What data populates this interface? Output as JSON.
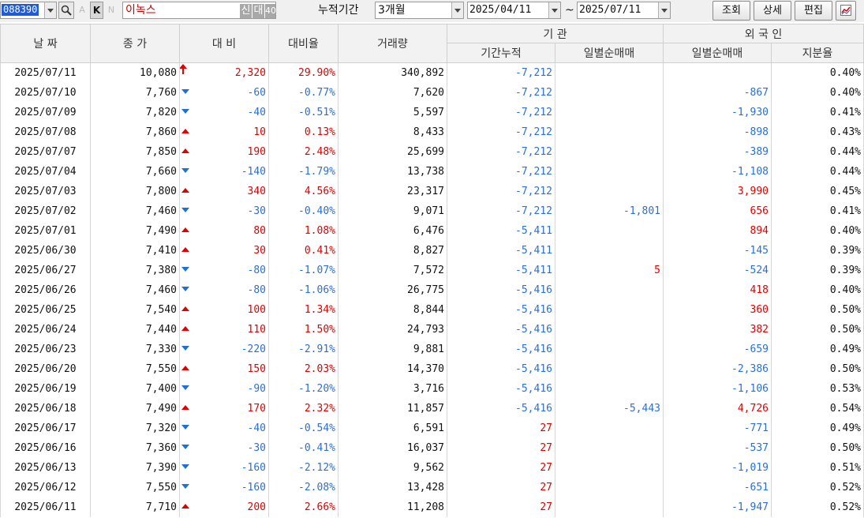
{
  "toolbar": {
    "code": "088390",
    "name": "이녹스",
    "new_badge": "신",
    "loan_badge": "대",
    "margin_badge": "40",
    "a_label": "A",
    "k_label": "K",
    "n_label": "N",
    "period_label": "누적기간",
    "period_value": "3개월",
    "start_date": "2025/04/11",
    "date_sep": "~",
    "end_date": "2025/07/11",
    "query_btn": "조회",
    "detail_btn": "상세",
    "edit_btn": "편집"
  },
  "headers": {
    "date": "날  짜",
    "close": "종  가",
    "change": "대  비",
    "change_rate": "대비율",
    "volume": "거래량",
    "institution": "기    관",
    "inst_cum": "기간누적",
    "inst_daily": "일별순매매",
    "foreign": "외 국 인",
    "foreign_daily": "일별순매매",
    "foreign_ratio": "지분율"
  },
  "colors": {
    "up": "#e00000",
    "down": "#2a6fd6",
    "highlight": "#1f5bd6"
  },
  "rows": [
    {
      "date": "2025/07/11",
      "close": "10,080",
      "dir": "upper",
      "change": "2,320",
      "rate": "29.90%",
      "volume": "340,892",
      "inst_cum": "-7,212",
      "inst_daily": "",
      "frgn": "",
      "frgn_dir": "",
      "ratio": "0.40%"
    },
    {
      "date": "2025/07/10",
      "close": "7,760",
      "dir": "down",
      "change": "-60",
      "rate": "-0.77%",
      "volume": "7,620",
      "inst_cum": "-7,212",
      "inst_daily": "",
      "frgn": "-867",
      "frgn_dir": "down",
      "ratio": "0.40%"
    },
    {
      "date": "2025/07/09",
      "close": "7,820",
      "dir": "down",
      "change": "-40",
      "rate": "-0.51%",
      "volume": "5,597",
      "inst_cum": "-7,212",
      "inst_daily": "",
      "frgn": "-1,930",
      "frgn_dir": "down",
      "ratio": "0.41%"
    },
    {
      "date": "2025/07/08",
      "close": "7,860",
      "dir": "up",
      "change": "10",
      "rate": "0.13%",
      "volume": "8,433",
      "inst_cum": "-7,212",
      "inst_daily": "",
      "frgn": "-898",
      "frgn_dir": "down",
      "ratio": "0.43%"
    },
    {
      "date": "2025/07/07",
      "close": "7,850",
      "dir": "up",
      "change": "190",
      "rate": "2.48%",
      "volume": "25,699",
      "inst_cum": "-7,212",
      "inst_daily": "",
      "frgn": "-389",
      "frgn_dir": "down",
      "ratio": "0.44%"
    },
    {
      "date": "2025/07/04",
      "close": "7,660",
      "dir": "down",
      "change": "-140",
      "rate": "-1.79%",
      "volume": "13,738",
      "inst_cum": "-7,212",
      "inst_daily": "",
      "frgn": "-1,108",
      "frgn_dir": "down",
      "ratio": "0.44%"
    },
    {
      "date": "2025/07/03",
      "close": "7,800",
      "dir": "up",
      "change": "340",
      "rate": "4.56%",
      "volume": "23,317",
      "inst_cum": "-7,212",
      "inst_daily": "",
      "frgn": "3,990",
      "frgn_dir": "up",
      "ratio": "0.45%"
    },
    {
      "date": "2025/07/02",
      "close": "7,460",
      "dir": "down",
      "change": "-30",
      "rate": "-0.40%",
      "volume": "9,071",
      "inst_cum": "-7,212",
      "inst_daily": "-1,801",
      "inst_daily_dir": "down",
      "frgn": "656",
      "frgn_dir": "up",
      "ratio": "0.41%"
    },
    {
      "date": "2025/07/01",
      "close": "7,490",
      "dir": "up",
      "change": "80",
      "rate": "1.08%",
      "volume": "6,476",
      "inst_cum": "-5,411",
      "inst_daily": "",
      "frgn": "894",
      "frgn_dir": "up",
      "ratio": "0.40%"
    },
    {
      "date": "2025/06/30",
      "close": "7,410",
      "dir": "up",
      "change": "30",
      "rate": "0.41%",
      "volume": "8,827",
      "inst_cum": "-5,411",
      "inst_daily": "",
      "frgn": "-145",
      "frgn_dir": "down",
      "ratio": "0.39%"
    },
    {
      "date": "2025/06/27",
      "close": "7,380",
      "dir": "down",
      "change": "-80",
      "rate": "-1.07%",
      "volume": "7,572",
      "inst_cum": "-5,411",
      "inst_daily": "5",
      "inst_daily_dir": "up",
      "frgn": "-524",
      "frgn_dir": "down",
      "ratio": "0.39%"
    },
    {
      "date": "2025/06/26",
      "close": "7,460",
      "dir": "down",
      "change": "-80",
      "rate": "-1.06%",
      "volume": "26,775",
      "inst_cum": "-5,416",
      "inst_daily": "",
      "frgn": "418",
      "frgn_dir": "up",
      "ratio": "0.40%"
    },
    {
      "date": "2025/06/25",
      "close": "7,540",
      "dir": "up",
      "change": "100",
      "rate": "1.34%",
      "volume": "8,844",
      "inst_cum": "-5,416",
      "inst_daily": "",
      "frgn": "360",
      "frgn_dir": "up",
      "ratio": "0.50%"
    },
    {
      "date": "2025/06/24",
      "close": "7,440",
      "dir": "up",
      "change": "110",
      "rate": "1.50%",
      "volume": "24,793",
      "inst_cum": "-5,416",
      "inst_daily": "",
      "frgn": "382",
      "frgn_dir": "up",
      "ratio": "0.50%"
    },
    {
      "date": "2025/06/23",
      "close": "7,330",
      "dir": "down",
      "change": "-220",
      "rate": "-2.91%",
      "volume": "9,881",
      "inst_cum": "-5,416",
      "inst_daily": "",
      "frgn": "-659",
      "frgn_dir": "down",
      "ratio": "0.49%"
    },
    {
      "date": "2025/06/20",
      "close": "7,550",
      "dir": "up",
      "change": "150",
      "rate": "2.03%",
      "volume": "14,370",
      "inst_cum": "-5,416",
      "inst_daily": "",
      "frgn": "-2,386",
      "frgn_dir": "down",
      "ratio": "0.50%"
    },
    {
      "date": "2025/06/19",
      "close": "7,400",
      "dir": "down",
      "change": "-90",
      "rate": "-1.20%",
      "volume": "3,716",
      "inst_cum": "-5,416",
      "inst_daily": "",
      "frgn": "-1,106",
      "frgn_dir": "down",
      "ratio": "0.53%"
    },
    {
      "date": "2025/06/18",
      "close": "7,490",
      "dir": "up",
      "change": "170",
      "rate": "2.32%",
      "volume": "11,857",
      "inst_cum": "-5,416",
      "inst_daily": "-5,443",
      "inst_daily_dir": "down",
      "frgn": "4,726",
      "frgn_dir": "up",
      "ratio": "0.54%"
    },
    {
      "date": "2025/06/17",
      "close": "7,320",
      "dir": "down",
      "change": "-40",
      "rate": "-0.54%",
      "volume": "6,591",
      "inst_cum": "27",
      "inst_cum_dir": "up",
      "inst_daily": "",
      "frgn": "-771",
      "frgn_dir": "down",
      "ratio": "0.49%"
    },
    {
      "date": "2025/06/16",
      "close": "7,360",
      "dir": "down",
      "change": "-30",
      "rate": "-0.41%",
      "volume": "16,037",
      "inst_cum": "27",
      "inst_cum_dir": "up",
      "inst_daily": "",
      "frgn": "-537",
      "frgn_dir": "down",
      "ratio": "0.50%"
    },
    {
      "date": "2025/06/13",
      "close": "7,390",
      "dir": "down",
      "change": "-160",
      "rate": "-2.12%",
      "volume": "9,562",
      "inst_cum": "27",
      "inst_cum_dir": "up",
      "inst_daily": "",
      "frgn": "-1,019",
      "frgn_dir": "down",
      "ratio": "0.51%"
    },
    {
      "date": "2025/06/12",
      "close": "7,550",
      "dir": "down",
      "change": "-160",
      "rate": "-2.08%",
      "volume": "13,428",
      "inst_cum": "27",
      "inst_cum_dir": "up",
      "inst_daily": "",
      "frgn": "-651",
      "frgn_dir": "down",
      "ratio": "0.52%"
    },
    {
      "date": "2025/06/11",
      "close": "7,710",
      "dir": "up",
      "change": "200",
      "rate": "2.66%",
      "volume": "11,208",
      "inst_cum": "27",
      "inst_cum_dir": "up",
      "inst_daily": "",
      "frgn": "-1,947",
      "frgn_dir": "down",
      "ratio": "0.52%"
    }
  ]
}
